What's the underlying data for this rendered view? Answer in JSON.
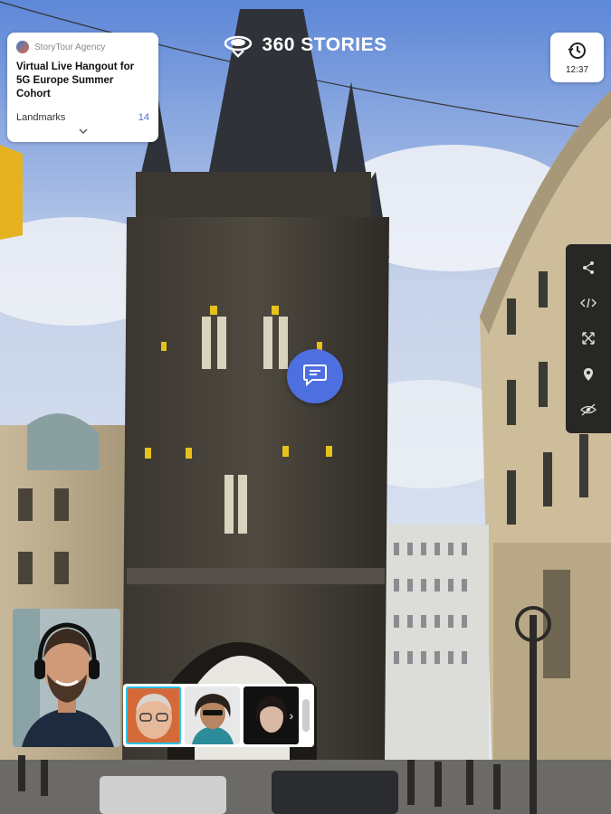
{
  "brand": {
    "name": "360 STORIES",
    "logo_icon": "headset-globe-icon"
  },
  "story_card": {
    "agency": "StoryTour Agency",
    "title": "Virtual Live Hangout for 5G Europe Summer Cohort",
    "section_label": "Landmarks",
    "section_count": "14",
    "expand_icon": "chevron-down-icon"
  },
  "clock": {
    "time": "12:37",
    "icon": "history-icon"
  },
  "toolbar": {
    "items": [
      "share-icon",
      "embed-code-icon",
      "fullscreen-icon",
      "location-pin-icon",
      "hide-eye-icon"
    ]
  },
  "chat": {
    "icon": "chat-bubble-icon",
    "color": "#4d6fe0"
  },
  "call": {
    "host": "host-video-tile",
    "participants": [
      "participant-1",
      "participant-2",
      "participant-3"
    ],
    "active_color": "#27c4e8"
  }
}
